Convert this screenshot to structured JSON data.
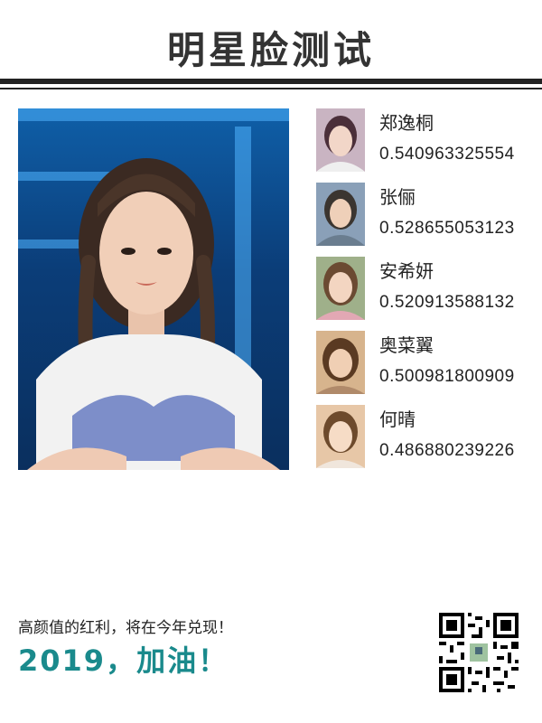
{
  "header": {
    "title": "明星脸测试"
  },
  "main_photo": {
    "icon": "portrait-photo"
  },
  "matches": [
    {
      "name": "郑逸桐",
      "score": "0.540963325554",
      "colors": [
        "#c9b4c2",
        "#4b2f3a"
      ]
    },
    {
      "name": "张俪",
      "score": "0.528655053123",
      "colors": [
        "#8aa0b8",
        "#3b3530"
      ]
    },
    {
      "name": "安希妍",
      "score": "0.520913588132",
      "colors": [
        "#9fb08a",
        "#6b4a32"
      ]
    },
    {
      "name": "奥菜翼",
      "score": "0.500981800909",
      "colors": [
        "#d7b48d",
        "#5a3a22"
      ]
    },
    {
      "name": "何晴",
      "score": "0.486880239226",
      "colors": [
        "#e7c7a7",
        "#6d4a2c"
      ]
    }
  ],
  "footer": {
    "slogan": "高颜值的红利，将在今年兑现！",
    "cheer": "2019，加油！",
    "accent": "#1a8a8c",
    "qr_icon": "qr-code"
  }
}
